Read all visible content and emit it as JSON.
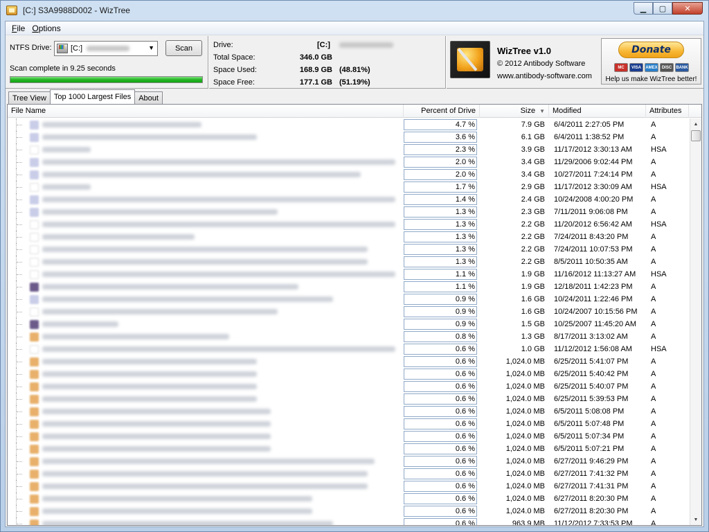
{
  "window": {
    "title": "[C:] S3A9988D002  - WizTree",
    "buttons": {
      "minimize": "▁",
      "maximize": "▢",
      "close": "✕"
    }
  },
  "menu": [
    {
      "label": "File"
    },
    {
      "label": "Options"
    }
  ],
  "scan_panel": {
    "drive_label": "NTFS Drive:",
    "drive_value": "[C:]",
    "scan_button": "Scan",
    "status": "Scan complete in 9.25 seconds",
    "progress_fraction": 1.0
  },
  "drive_stats": {
    "drive_label": "Drive:",
    "drive_value": "[C:]",
    "total_label": "Total Space:",
    "total_value": "346.0 GB",
    "used_label": "Space Used:",
    "used_value": "168.9 GB",
    "used_pct": "(48.81%)",
    "free_label": "Space Free:",
    "free_value": "177.1 GB",
    "free_pct": "(51.19%)"
  },
  "about": {
    "app_name": "WizTree v1.0",
    "copyright": "© 2012 Antibody Software",
    "website": "www.antibody-software.com"
  },
  "donate": {
    "button": "Donate",
    "cards": [
      "MC",
      "VISA",
      "AMEX",
      "DISC",
      "BANK"
    ],
    "card_colors": [
      "#c8312a",
      "#1a3d8f",
      "#2a7fc9",
      "#555555",
      "#2a5aa0"
    ],
    "text": "Help us make WizTree better!"
  },
  "tabs": [
    {
      "label": "Tree View",
      "active": false
    },
    {
      "label": "Top 1000 Largest Files",
      "active": true
    },
    {
      "label": "About",
      "active": false
    }
  ],
  "columns": {
    "name": "File Name",
    "percent": "Percent of Drive",
    "size": "Size",
    "modified": "Modified",
    "attributes": "Attributes"
  },
  "sort_icon": "sort-descending-icon",
  "files": [
    {
      "percent": "4.7 %",
      "size": "7.9 GB",
      "modified": "6/4/2011 2:27:05 PM",
      "attr": "A",
      "icon": "#c9cde8",
      "w": 230
    },
    {
      "percent": "3.6 %",
      "size": "6.1 GB",
      "modified": "6/4/2011 1:38:52 PM",
      "attr": "A",
      "icon": "#c9cde8",
      "w": 310
    },
    {
      "percent": "2.3 %",
      "size": "3.9 GB",
      "modified": "11/17/2012 3:30:13 AM",
      "attr": "HSA",
      "icon": "#ffffff",
      "w": 70
    },
    {
      "percent": "2.0 %",
      "size": "3.4 GB",
      "modified": "11/29/2006 9:02:44 PM",
      "attr": "A",
      "icon": "#c9cde8",
      "w": 510
    },
    {
      "percent": "2.0 %",
      "size": "3.4 GB",
      "modified": "10/27/2011 7:24:14 PM",
      "attr": "A",
      "icon": "#c9cde8",
      "w": 460
    },
    {
      "percent": "1.7 %",
      "size": "2.9 GB",
      "modified": "11/17/2012 3:30:09 AM",
      "attr": "HSA",
      "icon": "#ffffff",
      "w": 70
    },
    {
      "percent": "1.4 %",
      "size": "2.4 GB",
      "modified": "10/24/2008 4:00:20 PM",
      "attr": "A",
      "icon": "#c9cde8",
      "w": 510
    },
    {
      "percent": "1.3 %",
      "size": "2.3 GB",
      "modified": "7/11/2011 9:06:08 PM",
      "attr": "A",
      "icon": "#c9cde8",
      "w": 340
    },
    {
      "percent": "1.3 %",
      "size": "2.2 GB",
      "modified": "11/20/2012 6:56:42 AM",
      "attr": "HSA",
      "icon": "#ffffff",
      "w": 510
    },
    {
      "percent": "1.3 %",
      "size": "2.2 GB",
      "modified": "7/24/2011 8:43:20 PM",
      "attr": "A",
      "icon": "#ffffff",
      "w": 220
    },
    {
      "percent": "1.3 %",
      "size": "2.2 GB",
      "modified": "7/24/2011 10:07:53 PM",
      "attr": "A",
      "icon": "#ffffff",
      "w": 470
    },
    {
      "percent": "1.3 %",
      "size": "2.2 GB",
      "modified": "8/5/2011 10:50:35 AM",
      "attr": "A",
      "icon": "#ffffff",
      "w": 470
    },
    {
      "percent": "1.1 %",
      "size": "1.9 GB",
      "modified": "11/16/2012 11:13:27 AM",
      "attr": "HSA",
      "icon": "#ffffff",
      "w": 510
    },
    {
      "percent": "1.1 %",
      "size": "1.9 GB",
      "modified": "12/18/2011 1:42:23 PM",
      "attr": "A",
      "icon": "#6b5a8a",
      "w": 370
    },
    {
      "percent": "0.9 %",
      "size": "1.6 GB",
      "modified": "10/24/2011 1:22:46 PM",
      "attr": "A",
      "icon": "#c9cde8",
      "w": 420
    },
    {
      "percent": "0.9 %",
      "size": "1.6 GB",
      "modified": "10/24/2007 10:15:56 PM",
      "attr": "A",
      "icon": "#ffffff",
      "w": 340
    },
    {
      "percent": "0.9 %",
      "size": "1.5 GB",
      "modified": "10/25/2007 11:45:20 AM",
      "attr": "A",
      "icon": "#6b5a8a",
      "w": 110
    },
    {
      "percent": "0.8 %",
      "size": "1.3 GB",
      "modified": "8/17/2011 3:13:02 AM",
      "attr": "A",
      "icon": "#e8b06a",
      "w": 270
    },
    {
      "percent": "0.6 %",
      "size": "1.0 GB",
      "modified": "11/12/2012 1:56:08 AM",
      "attr": "HSA",
      "icon": "#ffffff",
      "w": 510
    },
    {
      "percent": "0.6 %",
      "size": "1,024.0 MB",
      "modified": "6/25/2011 5:41:07 PM",
      "attr": "A",
      "icon": "#e8b06a",
      "w": 310
    },
    {
      "percent": "0.6 %",
      "size": "1,024.0 MB",
      "modified": "6/25/2011 5:40:42 PM",
      "attr": "A",
      "icon": "#e8b06a",
      "w": 310
    },
    {
      "percent": "0.6 %",
      "size": "1,024.0 MB",
      "modified": "6/25/2011 5:40:07 PM",
      "attr": "A",
      "icon": "#e8b06a",
      "w": 310
    },
    {
      "percent": "0.6 %",
      "size": "1,024.0 MB",
      "modified": "6/25/2011 5:39:53 PM",
      "attr": "A",
      "icon": "#e8b06a",
      "w": 310
    },
    {
      "percent": "0.6 %",
      "size": "1,024.0 MB",
      "modified": "6/5/2011 5:08:08 PM",
      "attr": "A",
      "icon": "#e8b06a",
      "w": 330
    },
    {
      "percent": "0.6 %",
      "size": "1,024.0 MB",
      "modified": "6/5/2011 5:07:48 PM",
      "attr": "A",
      "icon": "#e8b06a",
      "w": 330
    },
    {
      "percent": "0.6 %",
      "size": "1,024.0 MB",
      "modified": "6/5/2011 5:07:34 PM",
      "attr": "A",
      "icon": "#e8b06a",
      "w": 330
    },
    {
      "percent": "0.6 %",
      "size": "1,024.0 MB",
      "modified": "6/5/2011 5:07:21 PM",
      "attr": "A",
      "icon": "#e8b06a",
      "w": 330
    },
    {
      "percent": "0.6 %",
      "size": "1,024.0 MB",
      "modified": "6/27/2011 9:46:29 PM",
      "attr": "A",
      "icon": "#e8b06a",
      "w": 480
    },
    {
      "percent": "0.6 %",
      "size": "1,024.0 MB",
      "modified": "6/27/2011 7:41:32 PM",
      "attr": "A",
      "icon": "#e8b06a",
      "w": 470
    },
    {
      "percent": "0.6 %",
      "size": "1,024.0 MB",
      "modified": "6/27/2011 7:41:31 PM",
      "attr": "A",
      "icon": "#e8b06a",
      "w": 470
    },
    {
      "percent": "0.6 %",
      "size": "1,024.0 MB",
      "modified": "6/27/2011 8:20:30 PM",
      "attr": "A",
      "icon": "#e8b06a",
      "w": 390
    },
    {
      "percent": "0.6 %",
      "size": "1,024.0 MB",
      "modified": "6/27/2011 8:20:30 PM",
      "attr": "A",
      "icon": "#e8b06a",
      "w": 390
    },
    {
      "percent": "0.6 %",
      "size": "963.9 MB",
      "modified": "11/12/2012 7:33:53 PM",
      "attr": "A",
      "icon": "#e8b06a",
      "w": 420
    }
  ]
}
